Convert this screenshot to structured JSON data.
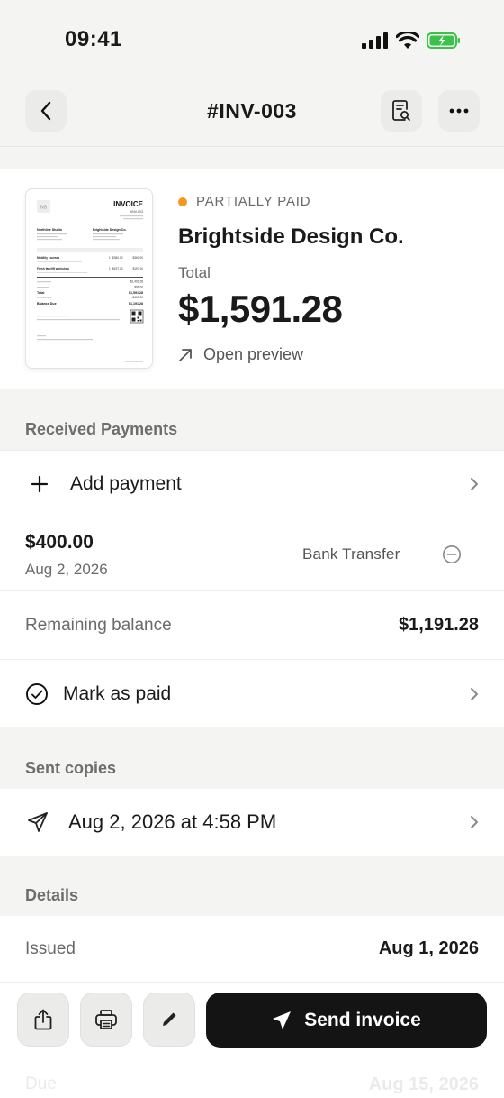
{
  "status_bar": {
    "time": "09:41"
  },
  "nav": {
    "title": "#INV-003"
  },
  "summary": {
    "status": "PARTIALLY PAID",
    "client": "Brightside Design Co.",
    "total_label": "Total",
    "total": "$1,591.28",
    "preview_label": "Open preview"
  },
  "thumbnail": {
    "heading": "INVOICE",
    "number": "#INV-003",
    "logo": "NS",
    "from_name": "Northline Studio",
    "to_name": "Brightside Design Co.",
    "items": [
      {
        "name": "Mobility courses",
        "qty": "1",
        "price": "$360.00",
        "amount": "$360.00"
      },
      {
        "name": "Fresh facelift workshop",
        "qty": "1",
        "price": "$197.10",
        "amount": "$197.10"
      }
    ],
    "subtotal": "$1,491.28",
    "tax": "$96.00",
    "total": "$1,591.28",
    "paid": "-$400.00",
    "balance_due": "$1,191.28",
    "total_word": "Total",
    "balance_word": "Balance Due"
  },
  "received": {
    "label": "Received Payments",
    "add_label": "Add payment",
    "payment": {
      "amount": "$400.00",
      "date": "Aug 2, 2026",
      "method": "Bank Transfer"
    },
    "remaining_label": "Remaining balance",
    "remaining_value": "$1,191.28",
    "mark_paid_label": "Mark as paid"
  },
  "sent": {
    "label": "Sent copies",
    "entry": "Aug 2, 2026 at 4:58 PM"
  },
  "details": {
    "label": "Details",
    "issued_label": "Issued",
    "issued_value": "Aug 1, 2026",
    "due_label": "Due",
    "due_value": "Aug 15, 2026"
  },
  "toolbar": {
    "send_label": "Send invoice"
  },
  "colors": {
    "accent": "#f29a1d",
    "dark": "#141414",
    "battery": "#3cc24a"
  }
}
